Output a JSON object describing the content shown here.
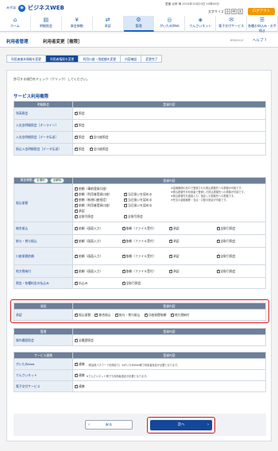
{
  "header": {
    "brand_mark": "みずほ",
    "brand": "ビジネスWEB",
    "user_line": "愛媛 太郎 様 2014年10月20日 10時50分",
    "fontsize_label": "文字サイズ",
    "fontsize_small": "小",
    "fontsize_mid": "中",
    "fontsize_large": "大",
    "logout": "ログアウト"
  },
  "nav": [
    {
      "icon": "⌂",
      "label": "ホーム",
      "name": "home"
    },
    {
      "icon": "▤",
      "label": "明細照会",
      "name": "inquiry"
    },
    {
      "icon": "¥",
      "label": "資金移動",
      "name": "transfer"
    },
    {
      "icon": "⇄",
      "label": "承認",
      "name": "approval"
    },
    {
      "icon": "⚙",
      "label": "管理",
      "name": "admin"
    },
    {
      "icon": "◎",
      "label": "がいためWeb",
      "name": "forex"
    },
    {
      "icon": "◈",
      "label": "でんさいネット",
      "name": "densai"
    },
    {
      "icon": "✉",
      "label": "電子交付サービス",
      "name": "edelivery"
    },
    {
      "icon": "☰",
      "label": "各種お申込み・お手続き",
      "name": "apply"
    }
  ],
  "title": {
    "main": "利用者管理",
    "sub": "利用者変更［権限］",
    "screen_code": "BRSK010",
    "help": "ヘルプ"
  },
  "steps": [
    "利用者基本情報を変更",
    "利用者権限を変更",
    "利用口座・限度額を変更",
    "内容確認",
    "変更完了"
  ],
  "message": "許可する項目をチェック（クリック）してください。",
  "section_title": "サービス利用権限",
  "col_service": "明細照会",
  "col_content": "登録内容",
  "inquiry": [
    {
      "label": "残高照会",
      "opts": [
        "照会"
      ]
    },
    {
      "label": "入出金明細照会［オンライン］",
      "opts": [
        "照会"
      ]
    },
    {
      "label": "入出金明細照会［データ伝送］",
      "opts": [
        "照会",
        "全口座照会"
      ]
    },
    {
      "label": "振込入金明細照会［データ伝送］",
      "opts": [
        "照会",
        "全口座照会"
      ]
    }
  ],
  "funds": {
    "header": "資金移動",
    "pill_all": "全選択",
    "pill_clear": "全解除",
    "furikomi_label": "振込振替",
    "furikomi_opts": [
      "依頼（事前登録口座）",
      "依頼（利用者登録口座）",
      "当日扱いを認める",
      "依頼（新規口座指定）",
      "当日扱いを認める",
      "依頼（利用者登録口座）",
      "当日扱いを認める",
      "承認",
      "全取引照会",
      "全取引照会"
    ],
    "furikomi_notes": [
      "※金融機関の窓口で登録された振込振替先への振替が可能です。",
      "※振込振替先を利用者で登録した振込振替先への振替が可能です。",
      "※振込振替先を直接入力、指定した振替先への振替です。",
      "※任意の金融機関・支店・口座の指定が可能です。"
    ],
    "rows": [
      {
        "label": "総合振込",
        "opts": [
          "依頼（画面入力）",
          "依頼（ファイル受付）",
          "承認",
          "全取引照会"
        ]
      },
      {
        "label": "給与・賞与振込",
        "opts": [
          "依頼（画面入力）",
          "依頼（ファイル受付）",
          "承認",
          "全取引照会"
        ]
      },
      {
        "label": "口座振替依頼",
        "opts": [
          "依頼（画面入力）",
          "依頼（ファイル受付）",
          "承認",
          "全取引照会"
        ]
      },
      {
        "label": "地方税納付",
        "opts": [
          "依頼（画面入力）",
          "依頼（ファイル受付）",
          "承認",
          "全取引照会"
        ]
      },
      {
        "label": "税金・各種料金の払込み",
        "opts": [
          "払込み",
          "全取引照会"
        ]
      }
    ]
  },
  "approval": {
    "header": "承認",
    "col_content": "登録内容",
    "label": "承認",
    "opts": [
      "振込振替",
      "総合振込",
      "給与・賞与振込",
      "口座振替依頼",
      "地方税納付"
    ]
  },
  "management": {
    "header": "管理",
    "col_content": "登録内容",
    "label": "操作履歴照会",
    "opts": [
      "全履歴照会"
    ]
  },
  "services": {
    "header": "サービス連携",
    "col_content": "登録内容",
    "rows": [
      {
        "label": "がいためWeb",
        "opt": "連携",
        "note": "（電話用パスワード利用あり）※がいためWeb側で利用者設定が必要となります。"
      },
      {
        "label": "でんさいネット",
        "opt": "連携",
        "note": "※でんさいネット側でも利用者設定が必要となります。"
      },
      {
        "label": "電子交付サービス",
        "opt": "連携",
        "note": ""
      }
    ]
  },
  "buttons": {
    "back": "戻る",
    "next": "次へ"
  },
  "colors": {
    "accent": "#14479a",
    "highlight": "#e0161e",
    "header_cell": "#6d7f99"
  }
}
